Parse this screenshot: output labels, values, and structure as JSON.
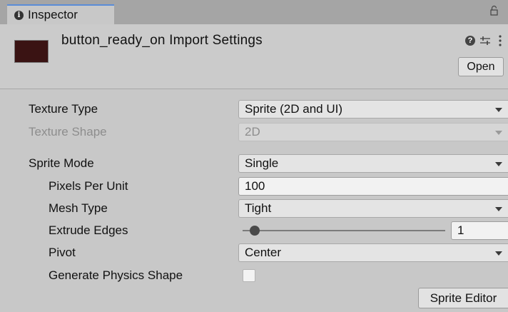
{
  "tab": {
    "title": "Inspector",
    "icon": "info-icon"
  },
  "header": {
    "title": "button_ready_on Import Settings",
    "thumbnail_color": "#3a1313",
    "open_button": "Open",
    "icons": [
      "help-icon",
      "sliders-icon",
      "kebab-icon",
      "lock-icon"
    ]
  },
  "props": {
    "texture_type": {
      "label": "Texture Type",
      "value": "Sprite (2D and UI)"
    },
    "texture_shape": {
      "label": "Texture Shape",
      "value": "2D"
    },
    "sprite_mode": {
      "label": "Sprite Mode",
      "value": "Single"
    },
    "pixels_per_unit": {
      "label": "Pixels Per Unit",
      "value": "100"
    },
    "mesh_type": {
      "label": "Mesh Type",
      "value": "Tight"
    },
    "extrude_edges": {
      "label": "Extrude Edges",
      "value": "1"
    },
    "pivot": {
      "label": "Pivot",
      "value": "Center"
    },
    "generate_physics_shape": {
      "label": "Generate Physics Shape",
      "checked": false
    }
  },
  "sprite_editor_button": "Sprite Editor",
  "colors": {
    "tab_accent": "#5a8cd8",
    "panel_bg": "#c8c8c8",
    "thumbnail": "#3a1313"
  }
}
